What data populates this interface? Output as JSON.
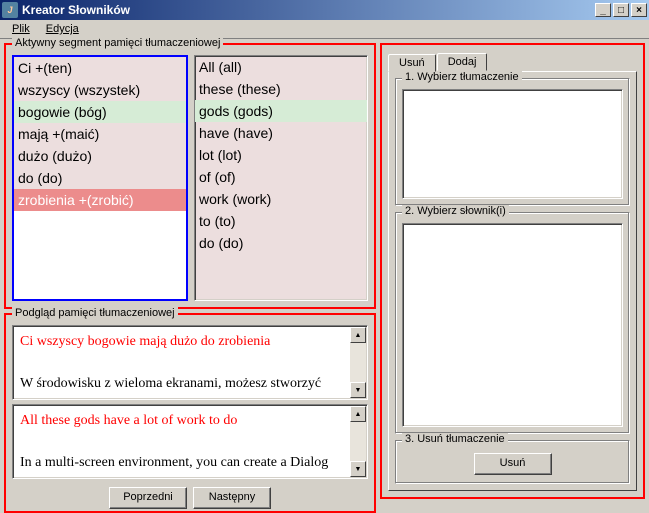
{
  "window": {
    "title": "Kreator Słowników"
  },
  "menu": {
    "file": "Plik",
    "edit": "Edycja"
  },
  "segment": {
    "legend": "Aktywny segment pamięci tłumaczeniowej",
    "left": [
      {
        "text": "Ci +(ten)",
        "state": ""
      },
      {
        "text": "wszyscy (wszystek)",
        "state": ""
      },
      {
        "text": "bogowie (bóg)",
        "state": "green"
      },
      {
        "text": "mają +(maić)",
        "state": ""
      },
      {
        "text": "dużo (dużo)",
        "state": ""
      },
      {
        "text": "do (do)",
        "state": ""
      },
      {
        "text": "zrobienia +(zrobić)",
        "state": "pink-sel"
      }
    ],
    "right": [
      {
        "text": "All (all)",
        "state": ""
      },
      {
        "text": "these (these)",
        "state": ""
      },
      {
        "text": "gods (gods)",
        "state": "green"
      },
      {
        "text": "have (have)",
        "state": ""
      },
      {
        "text": "lot (lot)",
        "state": ""
      },
      {
        "text": "of (of)",
        "state": ""
      },
      {
        "text": "work (work)",
        "state": ""
      },
      {
        "text": "to (to)",
        "state": ""
      },
      {
        "text": "do (do)",
        "state": ""
      }
    ]
  },
  "preview": {
    "legend": "Podgląd pamięci tłumaczeniowej",
    "box1_red": "Ci wszyscy bogowie mają dużo do zrobienia",
    "box1_blk": "W środowisku z wieloma ekranami, możesz stworzyć",
    "box2_red": "All these gods have a lot of work to do",
    "box2_blk": "In a multi-screen environment, you can create a Dialog",
    "prev_btn": "Poprzedni",
    "next_btn": "Następny"
  },
  "right": {
    "tab_delete": "Usuń",
    "tab_add": "Dodaj",
    "fs1_legend": "1. Wybierz tłumaczenie",
    "fs2_legend": "2. Wybierz słownik(i)",
    "fs3_legend": "3. Usuń tłumaczenie",
    "delete_btn": "Usuń"
  }
}
